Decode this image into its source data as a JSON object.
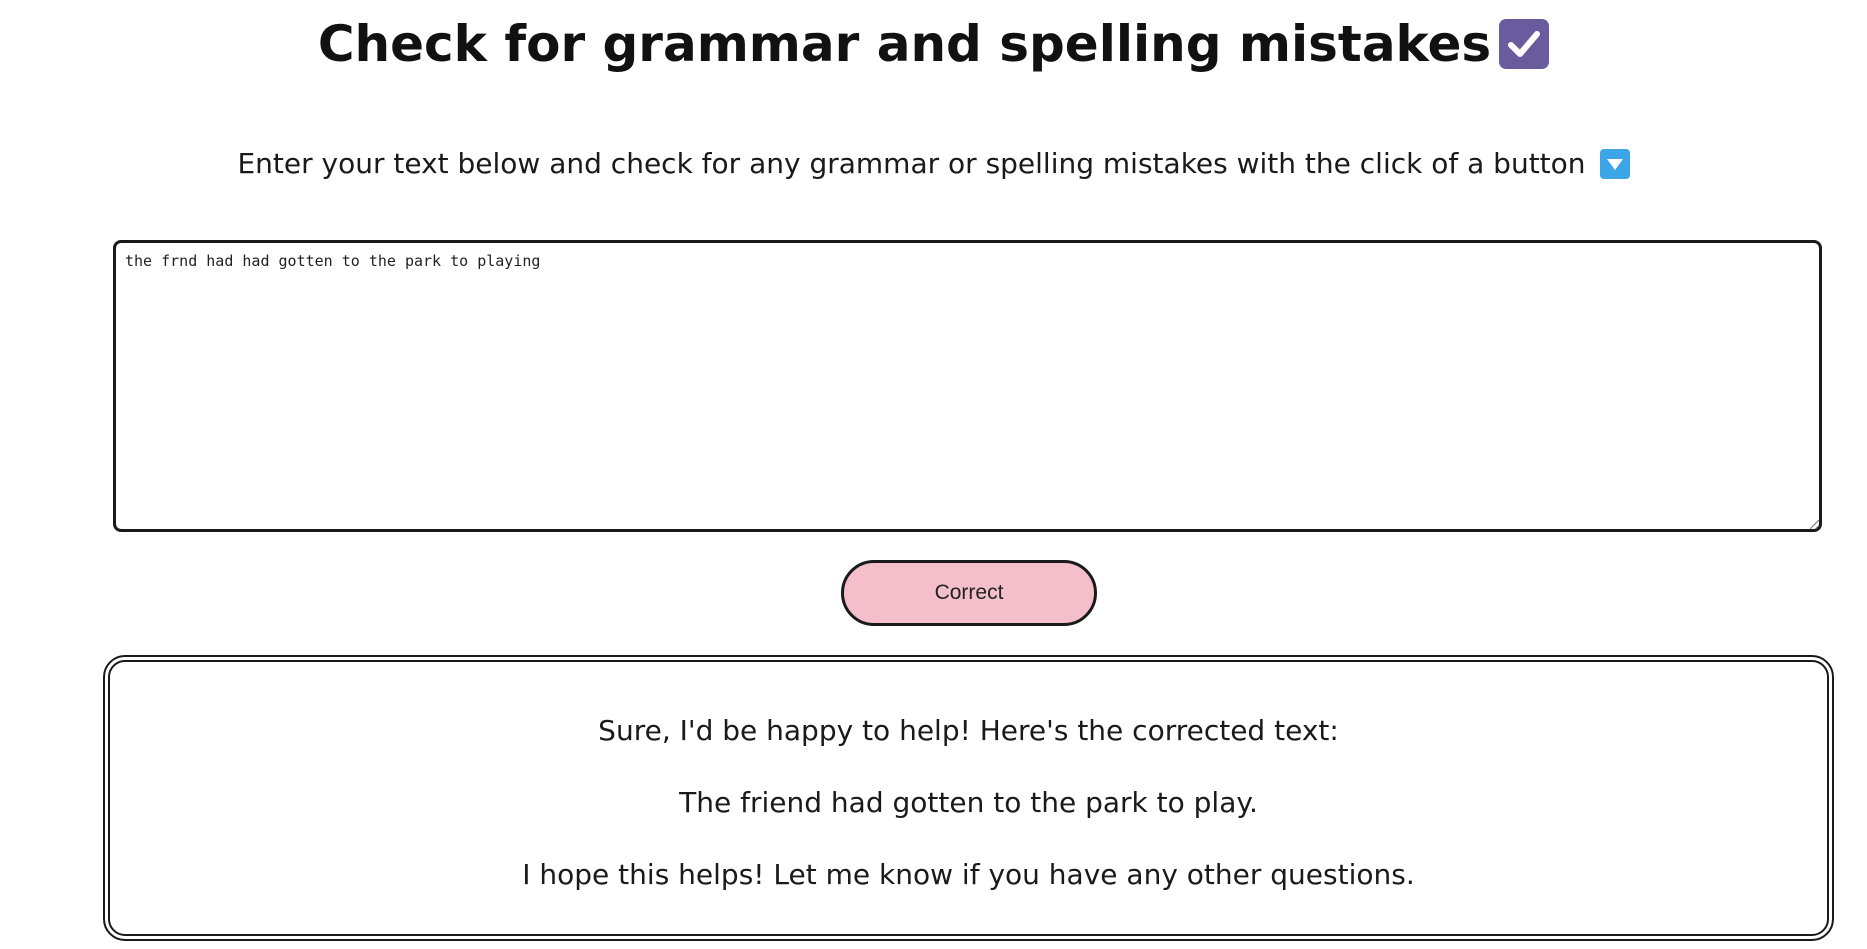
{
  "header": {
    "title": "Check for grammar and spelling mistakes",
    "title_icon": "check-mark-button-icon",
    "title_icon_color": "#6a5a9e"
  },
  "intro": {
    "text": "Enter your text below and check for any grammar or spelling mistakes with the click of a button",
    "icon": "down-arrow-button-icon",
    "icon_color": "#3ba5e8"
  },
  "input": {
    "value": "the frnd had had gotten to the park to playing",
    "misspelled_word": "frnd"
  },
  "actions": {
    "correct_label": "Correct",
    "correct_color": "#f4bfcb"
  },
  "result": {
    "lines": [
      "Sure, I'd be happy to help! Here's the corrected text:",
      "The friend had gotten to the park to play.",
      "I hope this helps! Let me know if you have any other questions."
    ]
  }
}
